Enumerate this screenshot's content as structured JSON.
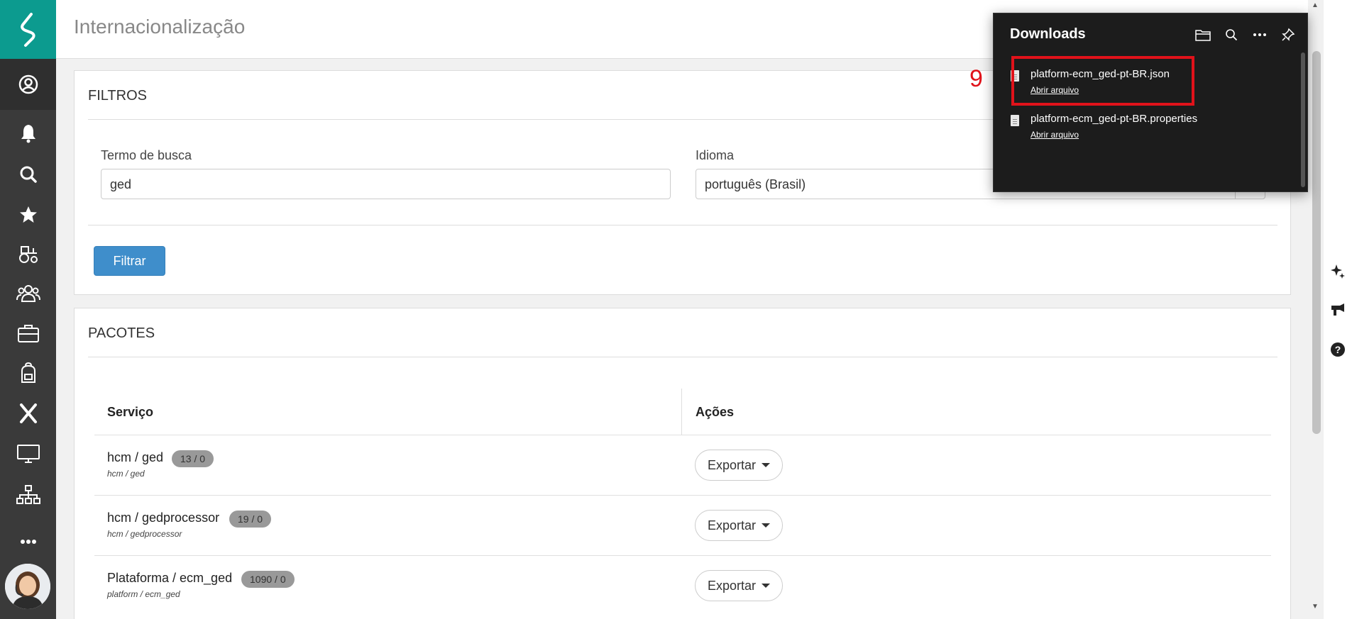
{
  "header": {
    "title": "Internacionalização"
  },
  "filters": {
    "title": "FILTROS",
    "search_label": "Termo de busca",
    "search_value": "ged",
    "language_label": "Idioma",
    "language_value": "português (Brasil)",
    "filter_button": "Filtrar"
  },
  "packages": {
    "title": "PACOTES",
    "col_service": "Serviço",
    "col_actions": "Ações",
    "rows": [
      {
        "name": "hcm / ged",
        "sub": "hcm / ged",
        "badge": "13 / 0",
        "action": "Exportar"
      },
      {
        "name": "hcm / gedprocessor",
        "sub": "hcm / gedprocessor",
        "badge": "19 / 0",
        "action": "Exportar"
      },
      {
        "name": "Plataforma / ecm_ged",
        "sub": "platform / ecm_ged",
        "badge": "1090 / 0",
        "action": "Exportar"
      }
    ]
  },
  "downloads": {
    "title": "Downloads",
    "items": [
      {
        "file": "platform-ecm_ged-pt-BR.json",
        "open": "Abrir arquivo"
      },
      {
        "file": "platform-ecm_ged-pt-BR.properties",
        "open": "Abrir arquivo"
      }
    ],
    "annotation_number": "9",
    "highlight_color": "#e0121a"
  },
  "sidebar_icons": [
    "logo-icon",
    "user-circle-icon",
    "bell-icon",
    "search-icon",
    "star-icon",
    "tractor-icon",
    "team-icon",
    "briefcase-icon",
    "backpack-icon",
    "x-icon",
    "monitor-icon",
    "org-chart-icon",
    "more-icon",
    "avatar"
  ],
  "colors": {
    "brand": "#0c9b8f",
    "rail": "#3a3a3a",
    "primary_button": "#3f8ecb"
  }
}
